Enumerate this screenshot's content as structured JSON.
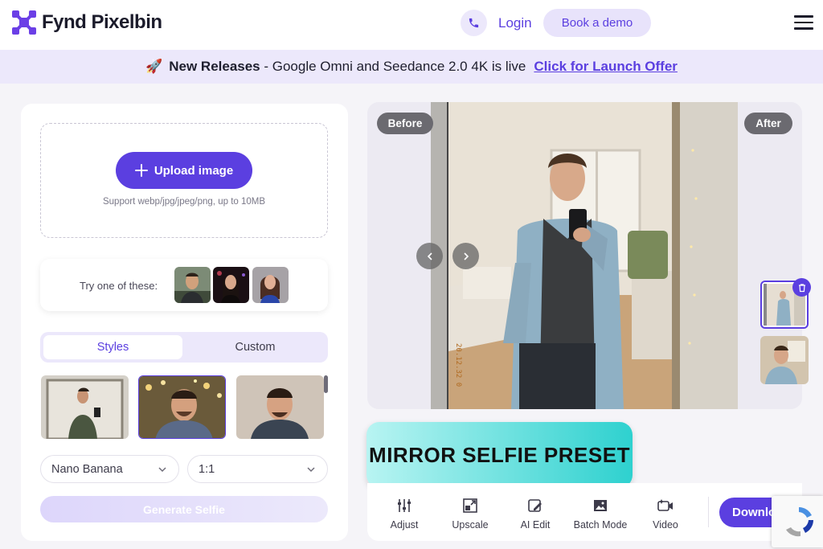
{
  "header": {
    "brand": "Fynd Pixelbin",
    "login_label": "Login",
    "demo_label": "Book a demo",
    "brand_color": "#5b3fe0"
  },
  "banner": {
    "emoji": "🚀",
    "headline": "New Releases",
    "text": " - Google Omni and Seedance 2.0 4K is live",
    "cta": "Click for Launch Offer"
  },
  "upload": {
    "button_label": "Upload image",
    "support_text": "Support webp/jpg/jpeg/png, up to 10MB"
  },
  "try": {
    "label": "Try one of these:"
  },
  "tabs": [
    {
      "label": "Styles",
      "active": true
    },
    {
      "label": "Custom",
      "active": false
    }
  ],
  "model_select": {
    "value": "Nano Banana"
  },
  "ratio_select": {
    "value": "1:1"
  },
  "generate_label": "Generate Selfie",
  "preview": {
    "before_label": "Before",
    "after_label": "After"
  },
  "preset_label": "MIRROR SELFIE PRESET",
  "tools": [
    {
      "label": "Adjust",
      "icon": "sliders-icon"
    },
    {
      "label": "Upscale",
      "icon": "upscale-icon"
    },
    {
      "label": "AI Edit",
      "icon": "ai-edit-icon"
    },
    {
      "label": "Batch Mode",
      "icon": "image-stack-icon"
    },
    {
      "label": "Video",
      "icon": "video-icon"
    }
  ],
  "download_label": "Download"
}
